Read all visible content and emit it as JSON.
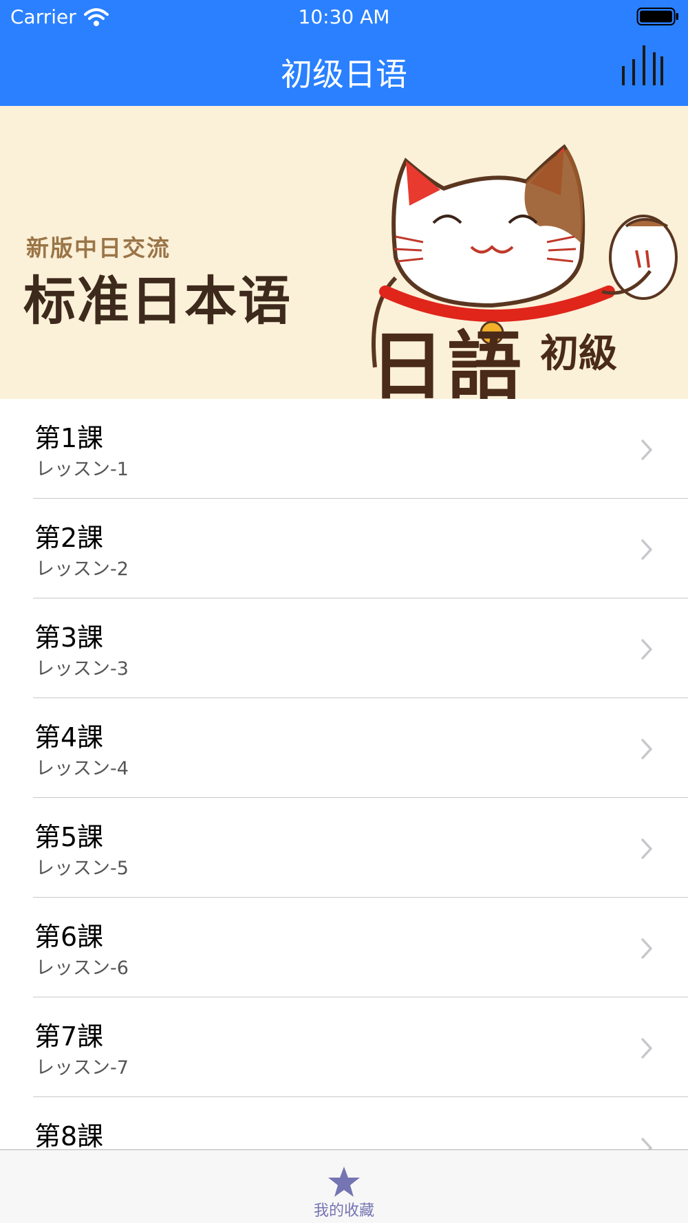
{
  "status_bar": {
    "carrier": "Carrier",
    "time": "10:30 AM",
    "wifi_icon": "wifi-icon",
    "battery_icon": "battery-icon"
  },
  "nav": {
    "title": "初级日语",
    "right_icon": "bar-chart-icon"
  },
  "banner": {
    "small_text": "新版中日交流",
    "big_text": "标准日本语",
    "script_text": "日語",
    "level_text": "初級",
    "image": "lucky-cat-illustration"
  },
  "lessons": [
    {
      "title": "第1課",
      "subtitle": "レッスン-1"
    },
    {
      "title": "第2課",
      "subtitle": "レッスン-2"
    },
    {
      "title": "第3課",
      "subtitle": "レッスン-3"
    },
    {
      "title": "第4課",
      "subtitle": "レッスン-4"
    },
    {
      "title": "第5課",
      "subtitle": "レッスン-5"
    },
    {
      "title": "第6課",
      "subtitle": "レッスン-6"
    },
    {
      "title": "第7課",
      "subtitle": "レッスン-7"
    },
    {
      "title": "第8課",
      "subtitle": ""
    }
  ],
  "tabbar": {
    "items": [
      {
        "label": "我的收藏",
        "icon": "star-icon"
      }
    ]
  },
  "colors": {
    "nav_background": "#2a80ff",
    "banner_background": "#fbf0d8",
    "tab_tint": "#7575b3",
    "separator": "#c8c8cc"
  }
}
